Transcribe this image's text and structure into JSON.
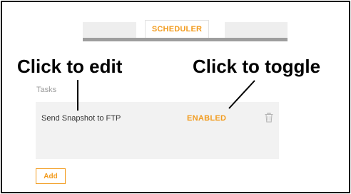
{
  "tabs": [
    {
      "label": ""
    },
    {
      "label": "SCHEDULER",
      "active": true
    },
    {
      "label": ""
    }
  ],
  "annotations": {
    "edit": "Click to edit",
    "toggle": "Click to toggle"
  },
  "tasks_section": {
    "label": "Tasks",
    "items": [
      {
        "name": "Send Snapshot to FTP",
        "status": "ENABLED",
        "action_icon": "trash-icon"
      }
    ]
  },
  "add_button": {
    "label": "Add"
  },
  "colors": {
    "accent": "#f29b1d",
    "panel": "#f2f2f2",
    "tab_bar": "#9e9e9e"
  }
}
